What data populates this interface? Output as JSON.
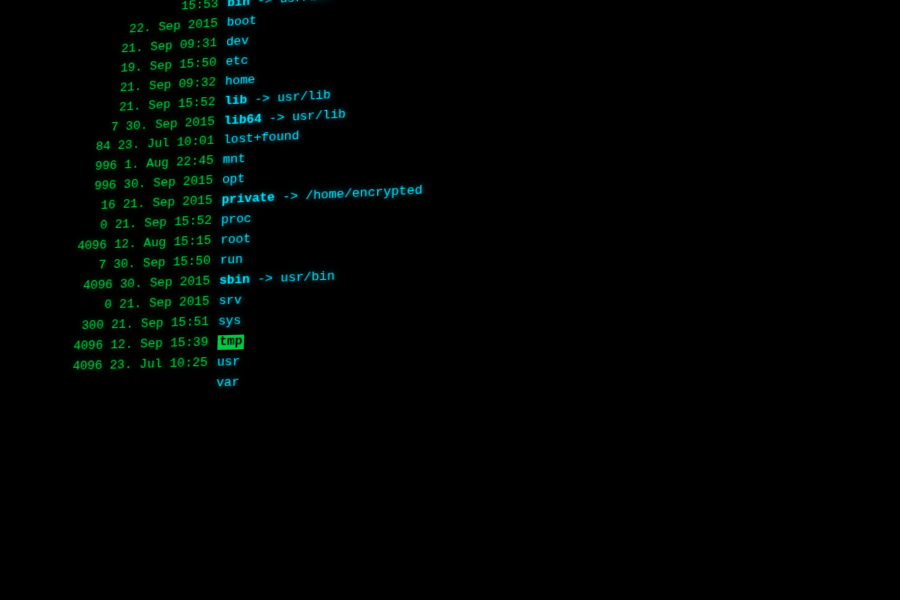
{
  "terminal": {
    "lines": [
      {
        "left": "15:53",
        "right_parts": [
          {
            "text": "bin",
            "class": "bold-cyan"
          },
          {
            "text": " -> usr/bin",
            "class": "cyan"
          }
        ]
      },
      {
        "left": "22. Sep  2015",
        "right_parts": [
          {
            "text": "boot",
            "class": "cyan"
          }
        ]
      },
      {
        "left": "21. Sep  09:31",
        "right_parts": [
          {
            "text": "dev",
            "class": "cyan"
          }
        ]
      },
      {
        "left": "19. Sep  15:50",
        "right_parts": [
          {
            "text": "etc",
            "class": "cyan"
          }
        ]
      },
      {
        "left": "21. Sep  09:32",
        "right_parts": [
          {
            "text": "home",
            "class": "cyan"
          }
        ]
      },
      {
        "left": "21. Sep  15:52",
        "right_parts": [
          {
            "text": "lib",
            "class": "bold-cyan"
          },
          {
            "text": " -> usr/lib",
            "class": "cyan"
          }
        ]
      },
      {
        "left": "7 30. Sep  2015",
        "right_parts": [
          {
            "text": "lib64",
            "class": "bold-cyan"
          },
          {
            "text": " -> usr/lib",
            "class": "cyan"
          }
        ]
      },
      {
        "left": "84 23. Jul  10:01",
        "right_parts": [
          {
            "text": "lost+found",
            "class": "cyan"
          }
        ]
      },
      {
        "left": "996 1. Aug  22:45",
        "right_parts": [
          {
            "text": "mnt",
            "class": "cyan"
          }
        ]
      },
      {
        "left": "996 30. Sep  2015",
        "right_parts": [
          {
            "text": "opt",
            "class": "cyan"
          }
        ]
      },
      {
        "left": "16 21. Sep  2015",
        "right_parts": [
          {
            "text": "private",
            "class": "bold-cyan"
          },
          {
            "text": " -> /home/encrypted",
            "class": "cyan"
          }
        ]
      },
      {
        "left": "0 21. Sep  15:52",
        "right_parts": [
          {
            "text": "proc",
            "class": "cyan"
          }
        ]
      },
      {
        "left": "4096 12. Aug  15:15",
        "right_parts": [
          {
            "text": "root",
            "class": "cyan"
          }
        ]
      },
      {
        "left": "7 30. Sep  15:50",
        "right_parts": [
          {
            "text": "run",
            "class": "cyan"
          }
        ]
      },
      {
        "left": "4096 30. Sep  2015",
        "right_parts": [
          {
            "text": "sbin",
            "class": "bold-cyan"
          },
          {
            "text": " -> usr/bin",
            "class": "cyan"
          }
        ]
      },
      {
        "left": "0 21. Sep  2015",
        "right_parts": [
          {
            "text": "srv",
            "class": "cyan"
          }
        ]
      },
      {
        "left": "300 21. Sep  15:51",
        "right_parts": [
          {
            "text": "sys",
            "class": "cyan"
          }
        ]
      },
      {
        "left": "4096 12. Sep  15:39",
        "right_parts": [
          {
            "text": "tmp",
            "class": "highlight-tmp"
          }
        ]
      },
      {
        "left": "4096 23. Jul  10:25",
        "right_parts": [
          {
            "text": "usr",
            "class": "cyan"
          }
        ]
      },
      {
        "left": "",
        "right_parts": [
          {
            "text": "var",
            "class": "cyan"
          }
        ]
      }
    ]
  }
}
